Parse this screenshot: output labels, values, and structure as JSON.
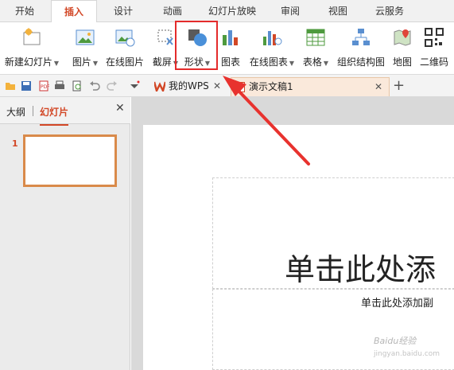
{
  "tabs": [
    "开始",
    "插入",
    "设计",
    "动画",
    "幻灯片放映",
    "审阅",
    "视图",
    "云服务"
  ],
  "active_tab": "插入",
  "ribbon": [
    {
      "label": "新建幻灯片",
      "icon": "new-slide-icon"
    },
    {
      "label": "图片",
      "icon": "picture-icon"
    },
    {
      "label": "在线图片",
      "icon": "online-picture-icon"
    },
    {
      "label": "截屏",
      "icon": "screenshot-icon"
    },
    {
      "label": "形状",
      "icon": "shapes-icon"
    },
    {
      "label": "图表",
      "icon": "chart-icon"
    },
    {
      "label": "在线图表",
      "icon": "online-chart-icon"
    },
    {
      "label": "表格",
      "icon": "table-icon"
    },
    {
      "label": "组织结构图",
      "icon": "org-chart-icon"
    },
    {
      "label": "地图",
      "icon": "map-icon"
    },
    {
      "label": "二维码",
      "icon": "qrcode-icon"
    }
  ],
  "doc_tabs": [
    {
      "label": "我的WPS",
      "icon": "wps-logo-icon"
    },
    {
      "label": "演示文稿1",
      "icon": "presentation-doc-icon"
    }
  ],
  "left_panel": {
    "tabs": [
      "大纲",
      "幻灯片"
    ],
    "active": "幻灯片",
    "slides": [
      "1"
    ]
  },
  "slide": {
    "title_placeholder": "单击此处添",
    "subtitle_placeholder": "单击此处添加副"
  },
  "watermark": {
    "text": "Baidu经验",
    "sub": "jingyan.baidu.com"
  },
  "colors": {
    "accent": "#d24726",
    "highlight": "#e42b2b",
    "doc_tab": "#fae9db"
  }
}
